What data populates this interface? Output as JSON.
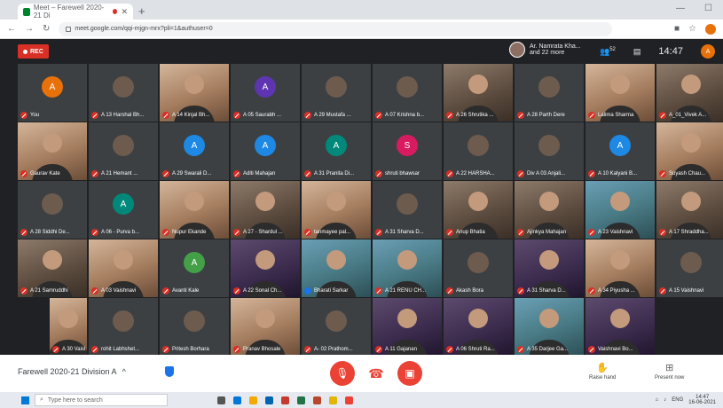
{
  "browser": {
    "tab_title": "Meet – Farewell 2020-21 Di",
    "url": "meet.google.com/qqi-mjgn-mrx?pli=1&authuser=0"
  },
  "topbar": {
    "rec_label": "REC",
    "presenter_name": "Ar. Namrata Kha...",
    "presenter_more": "and 22 more",
    "participants_count": "52",
    "clock": "14:47",
    "you_initial": "A"
  },
  "participants": [
    {
      "name": "You",
      "kind": "avatar",
      "initial": "A",
      "color": "#e8710a"
    },
    {
      "name": "A 13 Harshal Bh...",
      "kind": "photo"
    },
    {
      "name": "A 14 Kinjal Bh...",
      "kind": "video",
      "variant": "v2"
    },
    {
      "name": "A 05 Saurabh ...",
      "kind": "avatar",
      "initial": "A",
      "color": "#5e35b1"
    },
    {
      "name": "A 29 Mustafa ...",
      "kind": "photo"
    },
    {
      "name": "A 07 Krishna b...",
      "kind": "photo"
    },
    {
      "name": "A 26 Shrutika ...",
      "kind": "video",
      "variant": "v1"
    },
    {
      "name": "A 28 Parth Dere",
      "kind": "photo"
    },
    {
      "name": "Lalima Sharma",
      "kind": "video",
      "variant": "v2"
    },
    {
      "name": "A_01_Vivek A...",
      "kind": "video",
      "variant": "v1"
    },
    {
      "name": "Gaurav Kate",
      "kind": "video",
      "variant": "v2"
    },
    {
      "name": "A 21 Hemant ...",
      "kind": "photo"
    },
    {
      "name": "A 29 Swarali D...",
      "kind": "avatar",
      "initial": "A",
      "color": "#1e88e5"
    },
    {
      "name": "Aditi Mahajan",
      "kind": "avatar",
      "initial": "A",
      "color": "#1e88e5"
    },
    {
      "name": "A 31 Pranita Di...",
      "kind": "avatar",
      "initial": "A",
      "color": "#00897b"
    },
    {
      "name": "shruti bhawsar",
      "kind": "avatar",
      "initial": "S",
      "color": "#d81b60"
    },
    {
      "name": "A 22 HARSHA...",
      "kind": "photo"
    },
    {
      "name": "Div A 03 Anjali...",
      "kind": "photo"
    },
    {
      "name": "A 10 Kalyani B...",
      "kind": "avatar",
      "initial": "A",
      "color": "#1e88e5"
    },
    {
      "name": "Suyash Chau...",
      "kind": "video",
      "variant": "v2"
    },
    {
      "name": "A 28 Siddhi De...",
      "kind": "photo"
    },
    {
      "name": "A 06 - Purva b...",
      "kind": "avatar",
      "initial": "A",
      "color": "#00897b"
    },
    {
      "name": "Nupur Ekande",
      "kind": "video",
      "variant": "v2"
    },
    {
      "name": "A 27 - Shardul ...",
      "kind": "video",
      "variant": "v1"
    },
    {
      "name": "tanmayee pal...",
      "kind": "video",
      "variant": "v2"
    },
    {
      "name": "A 31 Sharva D...",
      "kind": "photo"
    },
    {
      "name": "Anup Bhatia",
      "kind": "video",
      "variant": "v1"
    },
    {
      "name": "Ajinkya Mahajan",
      "kind": "video",
      "variant": "v1"
    },
    {
      "name": "A 23 Vaishnavi",
      "kind": "video",
      "variant": "v4"
    },
    {
      "name": "A 17 Shraddha...",
      "kind": "video",
      "variant": "v1"
    },
    {
      "name": "A 21 Samruddhi",
      "kind": "video",
      "variant": "v1"
    },
    {
      "name": "A 03 Vaishnavi",
      "kind": "video",
      "variant": "v2"
    },
    {
      "name": "Avanti Kale",
      "kind": "avatar",
      "initial": "A",
      "color": "#43a047"
    },
    {
      "name": "A 22 Sonal Ch...",
      "kind": "video",
      "variant": "v5"
    },
    {
      "name": "Bharati Sarkar",
      "kind": "video",
      "variant": "v4",
      "speaking": true
    },
    {
      "name": "A 21 RENU CH...",
      "kind": "video",
      "variant": "v4"
    },
    {
      "name": "Akash Bora",
      "kind": "photo"
    },
    {
      "name": "A 31 Sharva D...",
      "kind": "video",
      "variant": "v5"
    },
    {
      "name": "A 34 Piyusha ...",
      "kind": "video",
      "variant": "v2"
    },
    {
      "name": "A 15 Vaishnavi",
      "kind": "photo"
    },
    {
      "name": "A 30 Vaishnavi",
      "kind": "video",
      "variant": "v2"
    },
    {
      "name": "rohit Labhshet...",
      "kind": "photo"
    },
    {
      "name": "Pritesh Borhara",
      "kind": "photo"
    },
    {
      "name": "Pranav Bhosale",
      "kind": "video",
      "variant": "v2"
    },
    {
      "name": "A- 02 Prathom...",
      "kind": "photo"
    },
    {
      "name": "A 11 Gajanan",
      "kind": "video",
      "variant": "v5"
    },
    {
      "name": "A 06 Shruti Ra...",
      "kind": "video",
      "variant": "v5"
    },
    {
      "name": "A 35 Darjee Ga...",
      "kind": "video",
      "variant": "v4"
    },
    {
      "name": "Vaishnavi Bo...",
      "kind": "video",
      "variant": "v5"
    }
  ],
  "bottombar": {
    "meeting_name": "Farewell 2020-21 Division A",
    "raise_hand_label": "Raise hand",
    "present_label": "Present now"
  },
  "taskbar": {
    "search_placeholder": "Type here to search",
    "lang": "ENG",
    "time": "14:47",
    "date": "16-06-2021"
  }
}
